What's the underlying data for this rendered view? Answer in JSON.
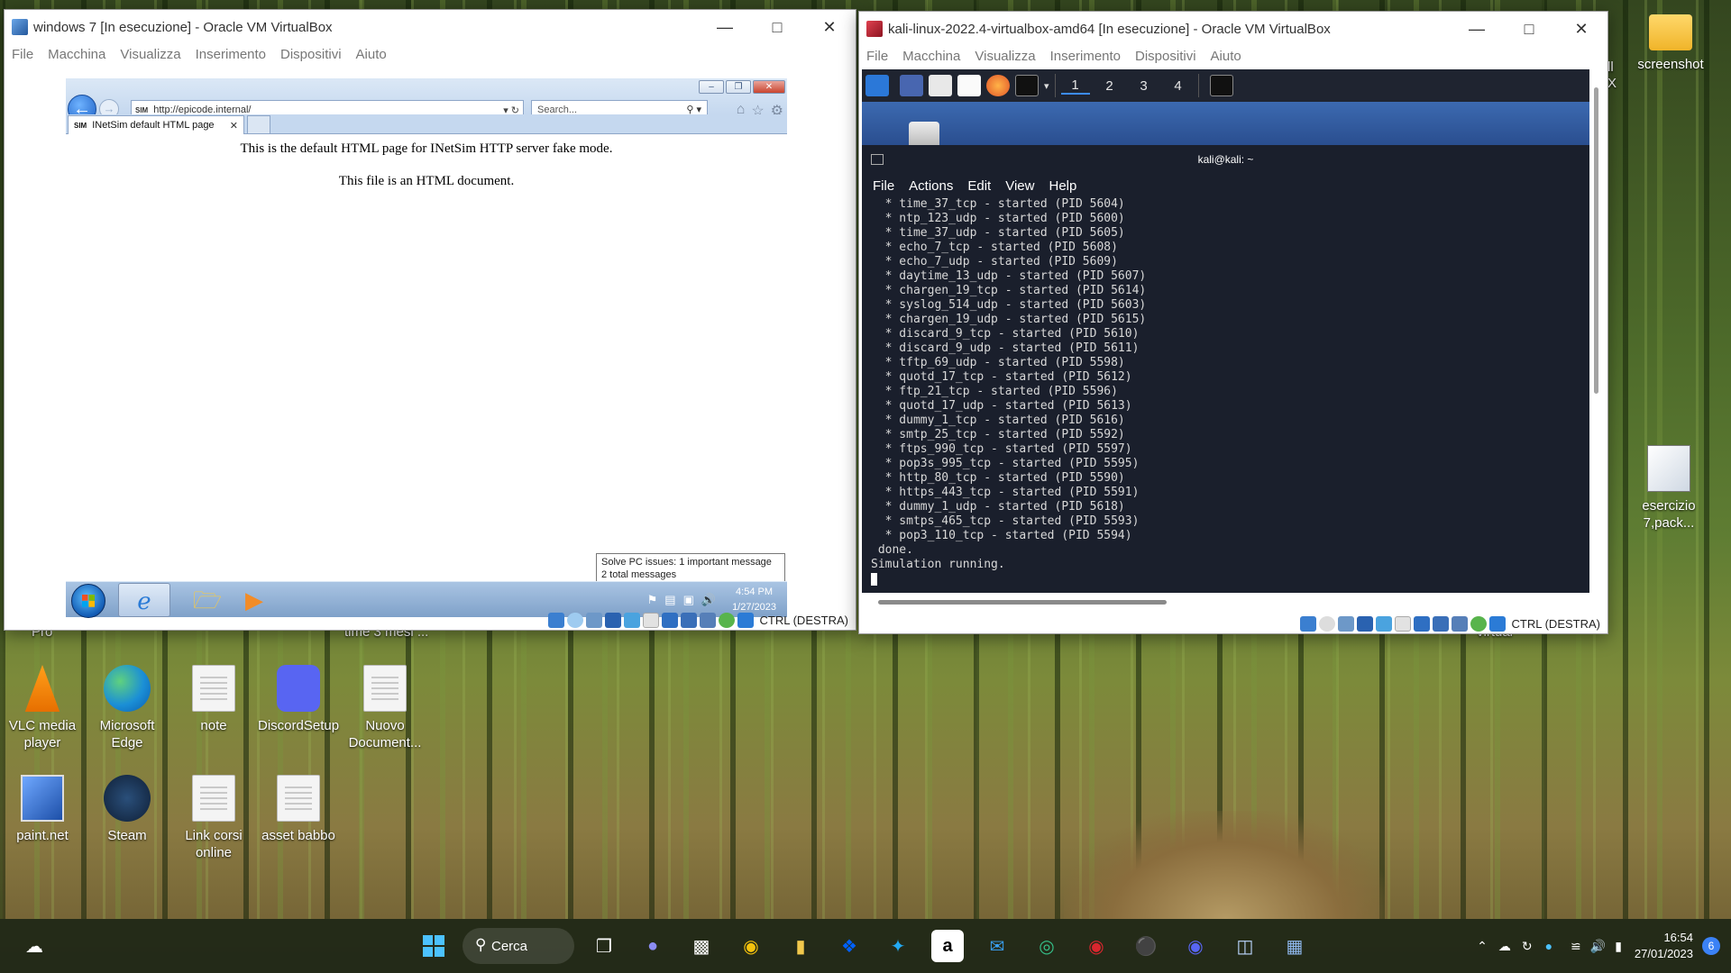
{
  "win7_vm": {
    "title": "windows 7 [In esecuzione] - Oracle VM VirtualBox",
    "menu": [
      "File",
      "Macchina",
      "Visualizza",
      "Inserimento",
      "Dispositivi",
      "Aiuto"
    ],
    "status_text": "CTRL (DESTRA)",
    "ie": {
      "address": "http://epicode.internal/",
      "address_badge": "SIM",
      "search_placeholder": "Search...",
      "tab_title": "INetSim default HTML page",
      "content_line1": "This is the default HTML page for INetSim HTTP server fake mode.",
      "content_line2": "This file is an HTML document."
    },
    "guest_taskbar": {
      "balloon_line1": "Solve PC issues: 1 important message",
      "balloon_line2": "2 total messages",
      "time": "4:54 PM",
      "date": "1/27/2023"
    }
  },
  "kali_vm": {
    "title": "kali-linux-2022.4-virtualbox-amd64 [In esecuzione] - Oracle VM VirtualBox",
    "menu": [
      "File",
      "Macchina",
      "Visualizza",
      "Inserimento",
      "Dispositivi",
      "Aiuto"
    ],
    "status_text": "CTRL (DESTRA)",
    "workspaces": [
      "1",
      "2",
      "3",
      "4"
    ],
    "terminal": {
      "title": "kali@kali: ~",
      "menu": [
        "File",
        "Actions",
        "Edit",
        "View",
        "Help"
      ],
      "lines": [
        "  * time_37_tcp - started (PID 5604)",
        "  * ntp_123_udp - started (PID 5600)",
        "  * time_37_udp - started (PID 5605)",
        "  * echo_7_tcp - started (PID 5608)",
        "  * echo_7_udp - started (PID 5609)",
        "  * daytime_13_udp - started (PID 5607)",
        "  * chargen_19_tcp - started (PID 5614)",
        "  * syslog_514_udp - started (PID 5603)",
        "  * chargen_19_udp - started (PID 5615)",
        "  * discard_9_tcp - started (PID 5610)",
        "  * discard_9_udp - started (PID 5611)",
        "  * tftp_69_udp - started (PID 5598)",
        "  * quotd_17_tcp - started (PID 5612)",
        "  * ftp_21_tcp - started (PID 5596)",
        "  * quotd_17_udp - started (PID 5613)",
        "  * dummy_1_tcp - started (PID 5616)",
        "  * smtp_25_tcp - started (PID 5592)",
        "  * ftps_990_tcp - started (PID 5597)",
        "  * pop3s_995_tcp - started (PID 5595)",
        "  * http_80_tcp - started (PID 5590)",
        "  * https_443_tcp - started (PID 5591)",
        "  * dummy_1_udp - started (PID 5618)",
        "  * smtps_465_tcp - started (PID 5593)",
        "  * pop3_110_tcp - started (PID 5594)",
        " done.",
        "Simulation running."
      ]
    }
  },
  "desktop": {
    "icons_row1": [
      {
        "label": "VLC media player",
        "icon": "vlc-icon"
      },
      {
        "label": "Microsoft Edge",
        "icon": "edge-icon"
      },
      {
        "label": "note",
        "icon": "document-icon"
      },
      {
        "label": "DiscordSetup",
        "icon": "discord-icon"
      },
      {
        "label": "Nuovo Document...",
        "icon": "document-icon"
      }
    ],
    "icons_row2": [
      {
        "label": "paint.net",
        "icon": "paintnet-icon"
      },
      {
        "label": "Steam",
        "icon": "steam-icon"
      },
      {
        "label": "Link corsi online",
        "icon": "document-icon"
      },
      {
        "label": "asset babbo",
        "icon": "document-icon"
      }
    ],
    "right_icons": [
      {
        "label": "screenshot",
        "icon": "folder-icon"
      },
      {
        "label": "esercizio 7,pack...",
        "icon": "wireshark-file-icon"
      }
    ],
    "partial_labels": {
      "pro": "Pro",
      "time": "time 3 mesi ...",
      "virtual": "virtual",
      "ix": "ll\nX"
    }
  },
  "taskbar": {
    "search_label": "Cerca",
    "time": "16:54",
    "date": "27/01/2023",
    "notification_count": "6"
  }
}
